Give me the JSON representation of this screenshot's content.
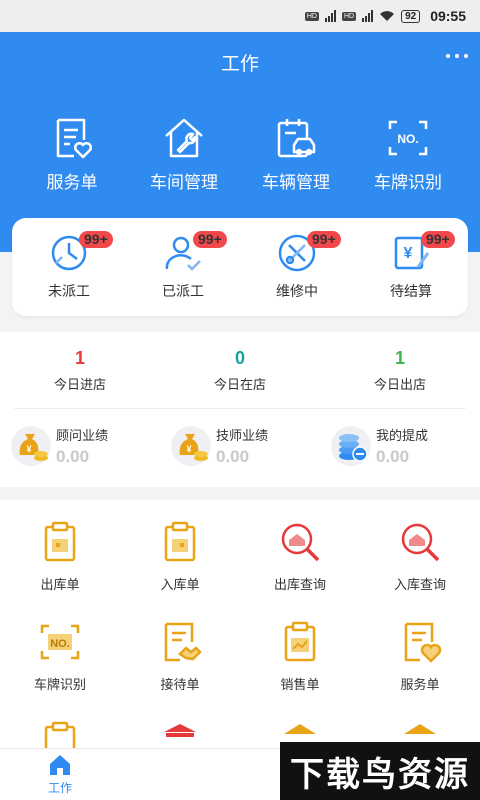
{
  "status_bar": {
    "hd1": "HD",
    "hd2": "HD",
    "net1": "5G",
    "net2": "5G",
    "battery": "92",
    "time": "09:55"
  },
  "header": {
    "title": "工作"
  },
  "quick_actions": [
    {
      "label": "服务单",
      "icon": "service-order-icon"
    },
    {
      "label": "车间管理",
      "icon": "workshop-icon"
    },
    {
      "label": "车辆管理",
      "icon": "vehicle-icon"
    },
    {
      "label": "车牌识别",
      "icon": "plate-scan-icon"
    }
  ],
  "work_status": [
    {
      "label": "未派工",
      "badge": "99+"
    },
    {
      "label": "已派工",
      "badge": "99+"
    },
    {
      "label": "维修中",
      "badge": "99+"
    },
    {
      "label": "待结算",
      "badge": "99+"
    }
  ],
  "today": [
    {
      "value": "1",
      "label": "今日进店",
      "color": "#e5393a"
    },
    {
      "value": "0",
      "label": "今日在店",
      "color": "#14a39a"
    },
    {
      "value": "1",
      "label": "今日出店",
      "color": "#3fb34f"
    }
  ],
  "performance": [
    {
      "label": "顾问业绩",
      "value": "0.00"
    },
    {
      "label": "技师业绩",
      "value": "0.00"
    },
    {
      "label": "我的提成",
      "value": "0.00"
    }
  ],
  "grid": [
    {
      "label": "出库单"
    },
    {
      "label": "入库单"
    },
    {
      "label": "出库查询"
    },
    {
      "label": "入库查询"
    },
    {
      "label": "车牌识别"
    },
    {
      "label": "接待单"
    },
    {
      "label": "销售单"
    },
    {
      "label": "服务单"
    }
  ],
  "tabbar": {
    "label": "工作"
  },
  "watermark": {
    "text": "下载鸟资源"
  },
  "colors": {
    "primary": "#2f8bf0",
    "badge": "#f3484b",
    "gold": "#e8a317",
    "red": "#e5393a"
  }
}
